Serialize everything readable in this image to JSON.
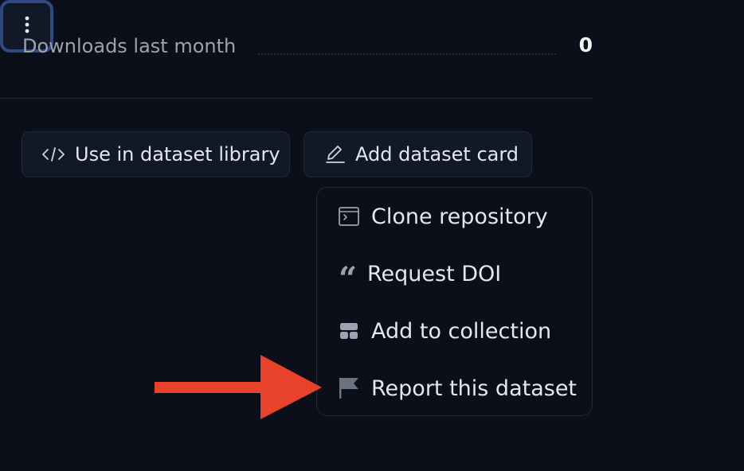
{
  "stats": {
    "downloads_label": "Downloads last month",
    "downloads_value": "0"
  },
  "actions": {
    "use_library": {
      "label": "Use in dataset library",
      "icon": "code-icon"
    },
    "add_card": {
      "label": "Add dataset card",
      "icon": "pencil-icon"
    },
    "more": {
      "icon": "vertical-ellipsis-icon"
    }
  },
  "menu": {
    "items": [
      {
        "label": "Clone repository",
        "icon": "terminal-icon"
      },
      {
        "label": "Request DOI",
        "icon": "quote-icon"
      },
      {
        "label": "Add to collection",
        "icon": "collection-icon"
      },
      {
        "label": "Report this dataset",
        "icon": "flag-icon"
      }
    ]
  },
  "annotation": {
    "icon": "arrow-right-icon",
    "color": "#e8432a"
  },
  "colors": {
    "background": "#0b0f19",
    "button_background": "#111827",
    "border": "#1f2937",
    "focus_ring": "#2f4a80",
    "text": "#e5e7eb",
    "muted_text": "#9ca3af"
  }
}
